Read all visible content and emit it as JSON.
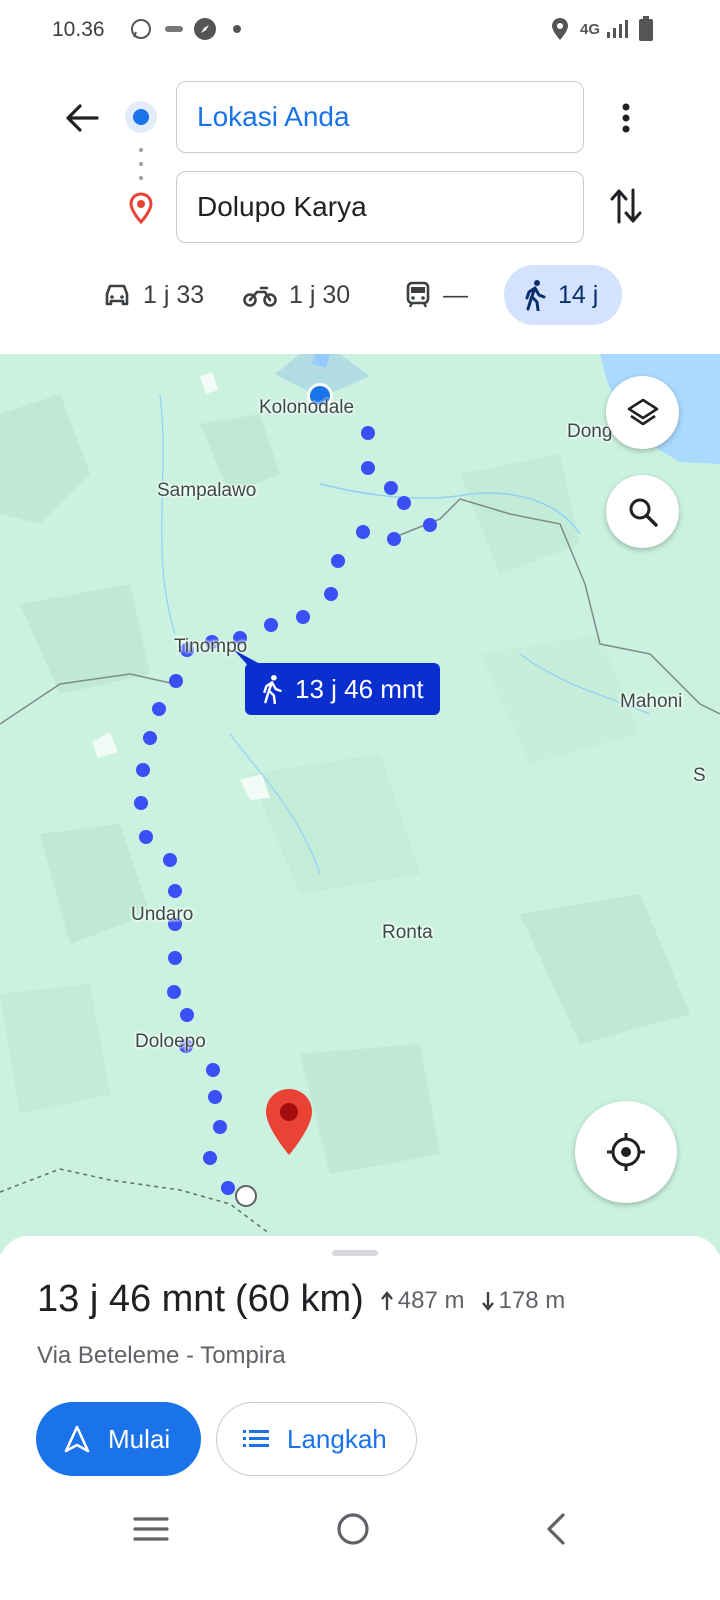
{
  "status_bar": {
    "time": "10.36",
    "network": "4G",
    "icons": [
      "whatsapp-icon",
      "messages-icon",
      "compass-icon",
      "dot-icon",
      "location-icon",
      "signal-icon",
      "battery-icon"
    ]
  },
  "header": {
    "origin": "Lokasi Anda",
    "destination": "Dolupo Karya",
    "modes": [
      {
        "name": "car",
        "label": "1 j 33"
      },
      {
        "name": "motorcycle",
        "label": "1 j 30"
      },
      {
        "name": "transit",
        "label": "—"
      },
      {
        "name": "walk",
        "label": "14 j",
        "active": true
      }
    ]
  },
  "map": {
    "labels": [
      "Kolonodale",
      "Dong",
      "Sampalawo",
      "Tinompo",
      "Mahoni",
      "S",
      "Undaro",
      "Ronta",
      "Doloepo"
    ],
    "route_tooltip": "13 j 46 mnt"
  },
  "sheet": {
    "duration": "13 j 46 mnt",
    "distance": "(60 km)",
    "ascent": "487 m",
    "descent": "178 m",
    "via": "Via Beteleme - Tompira",
    "start_label": "Mulai",
    "steps_label": "Langkah"
  },
  "colors": {
    "accent": "#1a73e8",
    "map_bg": "#cbf2e0",
    "route_dot": "#3a4ff5",
    "tooltip_bg": "#0a2fcf",
    "pin": "#ea4335"
  }
}
